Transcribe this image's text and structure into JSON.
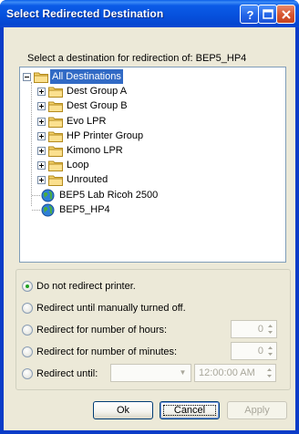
{
  "window": {
    "title": "Select Redirected Destination",
    "buttons": {
      "help": "?"
    }
  },
  "prompt": {
    "text": "Select a destination for redirection of: BEP5_HP4"
  },
  "tree": {
    "items": [
      {
        "label": "All Destinations",
        "icon": "folder-icon",
        "expander": "minus",
        "selected": true
      },
      {
        "label": "Dest Group A",
        "icon": "folder-icon",
        "expander": "plus"
      },
      {
        "label": "Dest Group B",
        "icon": "folder-icon",
        "expander": "plus"
      },
      {
        "label": "Evo LPR",
        "icon": "folder-icon",
        "expander": "plus"
      },
      {
        "label": "HP Printer Group",
        "icon": "folder-icon",
        "expander": "plus"
      },
      {
        "label": "Kimono LPR",
        "icon": "folder-icon",
        "expander": "plus"
      },
      {
        "label": "Loop",
        "icon": "folder-icon",
        "expander": "plus"
      },
      {
        "label": "Unrouted",
        "icon": "folder-icon",
        "expander": "plus"
      },
      {
        "label": "BEP5 Lab Ricoh 2500",
        "icon": "globe-icon",
        "expander": "none"
      },
      {
        "label": "BEP5_HP4",
        "icon": "globe-icon",
        "expander": "none"
      }
    ]
  },
  "options": {
    "do_not_redirect": "Do not redirect printer.",
    "until_manual": "Redirect until manually turned off.",
    "hours": "Redirect for number of hours:",
    "minutes": "Redirect for number of minutes:",
    "until": "Redirect until:",
    "selected": "do_not_redirect"
  },
  "fields": {
    "hours_value": "0",
    "minutes_value": "0",
    "until_date": "",
    "until_time": "12:00:00 AM"
  },
  "footer": {
    "ok": "Ok",
    "cancel": "Cancel",
    "apply": "Apply"
  },
  "colors": {
    "title_bar": "#0650dc",
    "selection": "#316ac5",
    "dialog_face": "#ece9d8"
  }
}
